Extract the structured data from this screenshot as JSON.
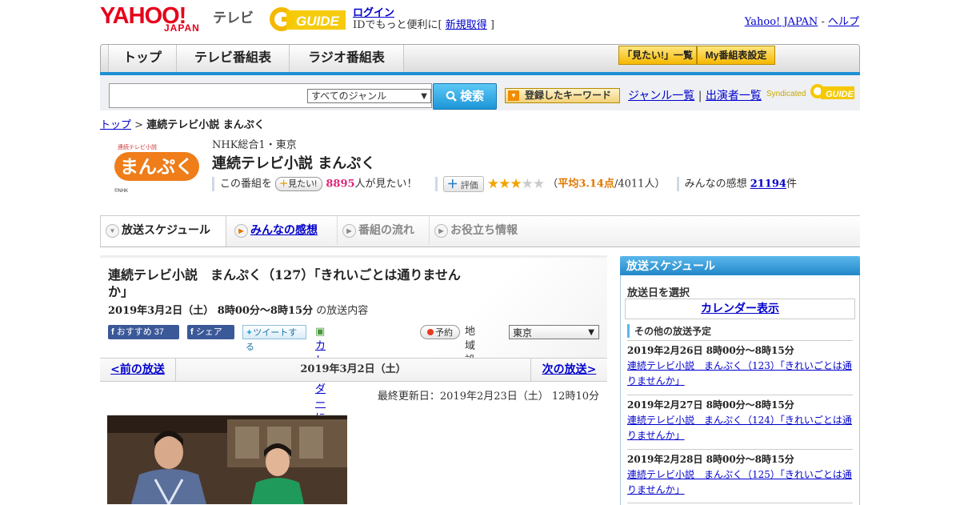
{
  "header": {
    "logo_yahoo": "YAHOO!",
    "logo_japan": "JAPAN",
    "logo_tv": "テレビ",
    "gguide": "GUIDE",
    "login": "ログイン",
    "login_sub_prefix": "IDでもっと便利に[ ",
    "signup": "新規取得",
    "login_sub_suffix": " ]",
    "yahoo_japan_link": "Yahoo! JAPAN",
    "dash": " - ",
    "help_link": "ヘルプ"
  },
  "nav": {
    "tabs": [
      "トップ",
      "テレビ番組表",
      "ラジオ番組表"
    ],
    "mitai_list": "「見たい!」一覧",
    "my_schedule": "My番組表設定"
  },
  "search": {
    "genre_value": "すべてのジャンル",
    "button": "検索",
    "keyword_button": "登録したキーワード",
    "genre_list": "ジャンル一覧",
    "separator": " | ",
    "performer_list": "出演者一覧",
    "syndicated": "Syndicated"
  },
  "breadcrumb": {
    "top": "トップ",
    "sep": " > ",
    "current": "連続テレビ小説 まんぷく"
  },
  "program": {
    "logo_text": "まんぷく",
    "logo_small": "連続テレビ小説",
    "logo_credit": "©NHK",
    "station": "NHK総合1・東京",
    "title": "連続テレビ小説 まんぷく",
    "mitai_prefix": "この番組を",
    "mitai_button": "見たい!",
    "mitai_count": "8895",
    "mitai_suffix": "人が見たい！",
    "rate_button": "評価",
    "rating": 3,
    "rating_max": 5,
    "avg_open": "（",
    "avg_label": "平均3.14点",
    "avg_people": "/4011人）",
    "kanso_label": "みんなの感想",
    "kanso_count": "21194",
    "kanso_suffix": "件"
  },
  "subtabs": [
    "放送スケジュール",
    "みんなの感想",
    "番組の流れ",
    "お役立ち情報"
  ],
  "episode": {
    "title": "連続テレビ小説　まんぷく（127）「きれいごとは通りませんか」",
    "date": "2019年3月2日（土）  8時00分～8時15分",
    "date_suffix": " の放送内容",
    "fb_recommend": "おすすめ",
    "fb_count": "37",
    "fb_share": "シェア",
    "tweet": "ツイートする",
    "calendar_register": "カレンダーに登録",
    "reserve": "予約",
    "region_label": "地域設定",
    "region_value": "東京",
    "prev": "<前の放送",
    "current_date": "2019年3月2日（土）",
    "next": "次の放送>",
    "updated": "最終更新日：2019年2月23日（土） 12時10分"
  },
  "sidebar": {
    "heading": "放送スケジュール",
    "select_date": "放送日を選択",
    "calendar": "カレンダー表示",
    "other": "その他の放送予定",
    "items": [
      {
        "date": "2019年2月26日  8時00分～8時15分",
        "title": "連続テレビ小説　まんぷく（123）「きれいごとは通りませんか」"
      },
      {
        "date": "2019年2月27日  8時00分～8時15分",
        "title": "連続テレビ小説　まんぷく（124）「きれいごとは通りませんか」"
      },
      {
        "date": "2019年2月28日  8時00分～8時15分",
        "title": "連続テレビ小説　まんぷく（125）「きれいごとは通りませんか」"
      }
    ]
  },
  "colors": {
    "accent": "#1d8fd5",
    "orange": "#ef7d1a",
    "link": "#0000cc"
  }
}
